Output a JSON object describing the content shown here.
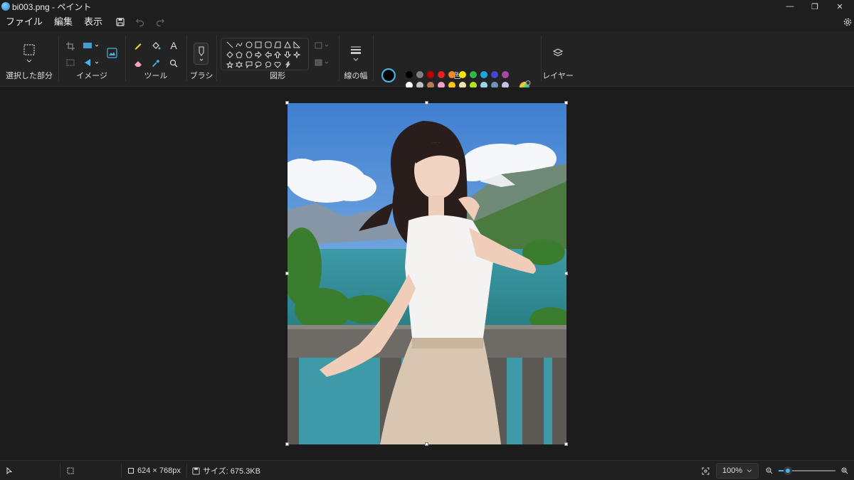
{
  "window": {
    "title": "bi003.png - ペイント",
    "minimize_glyph": "—",
    "restore_glyph": "❐",
    "close_glyph": "✕"
  },
  "menu": {
    "file": "ファイル",
    "edit": "編集",
    "view": "表示"
  },
  "ribbon": {
    "selection_label": "選択した部分",
    "image_label": "イメージ",
    "tools_label": "ツール",
    "brush_label": "ブラシ",
    "shapes_label": "図形",
    "stroke_label": "線の幅",
    "color_label": "色",
    "layers_label": "レイヤー",
    "text_tool_glyph": "A",
    "primary_color": "#000000",
    "secondary_color": "#ffffff",
    "palette_row1": [
      "#000000",
      "#7f7f7f",
      "#c00000",
      "#e8201f",
      "#ef8a22",
      "#f5e500",
      "#2fb74a",
      "#17a8e0",
      "#3f48cc",
      "#a349a4"
    ],
    "palette_row2": [
      "#ffffff",
      "#c3c3c3",
      "#b97a57",
      "#f4a2c8",
      "#ffc90e",
      "#efe4b0",
      "#b5e61d",
      "#99d9ea",
      "#7092be",
      "#c8bfe7"
    ]
  },
  "canvas": {
    "image_name": "bi003.png"
  },
  "status": {
    "dimensions": "624 × 768px",
    "size": "サイズ: 675.3KB",
    "zoom": "100%",
    "zoom_level": 0.16
  }
}
